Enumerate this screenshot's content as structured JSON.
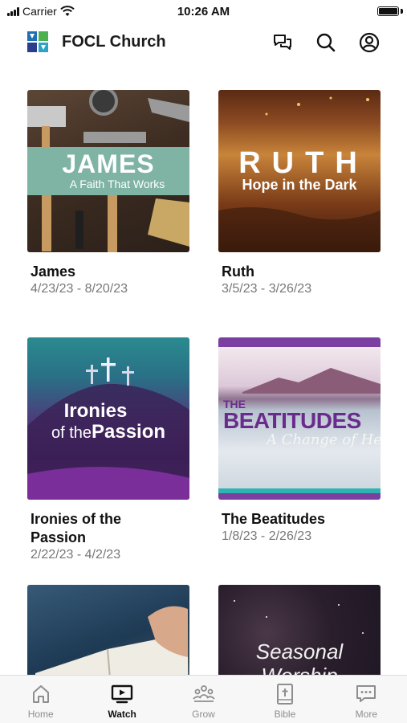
{
  "status_bar": {
    "carrier": "Carrier",
    "time": "10:26 AM"
  },
  "header": {
    "title": "FOCL Church"
  },
  "series": [
    {
      "title": "James",
      "dates": "4/23/23 - 8/20/23",
      "art_title": "JAMES",
      "art_subtitle": "A Faith That Works"
    },
    {
      "title": "Ruth",
      "dates": "3/5/23 - 3/26/23",
      "art_title": "RUTH",
      "art_subtitle": "Hope in the Dark"
    },
    {
      "title": "Ironies of the Passion",
      "dates": "2/22/23 - 4/2/23",
      "art_line1": "Ironies",
      "art_line2_prefix": "of the",
      "art_line2": "Passion"
    },
    {
      "title": "The Beatitudes",
      "dates": "1/8/23 - 2/26/23",
      "art_prefix": "THE",
      "art_title": "BEATITUDES",
      "art_subtitle": "A Change of Heart"
    },
    {
      "title": "",
      "dates": ""
    },
    {
      "title": "",
      "dates": "",
      "art_line1": "Seasonal",
      "art_line2": "Worship"
    }
  ],
  "tabs": [
    {
      "label": "Home",
      "icon": "home-icon",
      "active": false
    },
    {
      "label": "Watch",
      "icon": "tv-play-icon",
      "active": true
    },
    {
      "label": "Grow",
      "icon": "people-group-icon",
      "active": false
    },
    {
      "label": "Bible",
      "icon": "bible-icon",
      "active": false
    },
    {
      "label": "More",
      "icon": "chat-dots-icon",
      "active": false
    }
  ],
  "colors": {
    "active_tab": "#111111",
    "inactive_tab": "#8e8e8e",
    "date_text": "#777777",
    "logo_blue": "#1e6fb5",
    "logo_green": "#4caf50"
  }
}
